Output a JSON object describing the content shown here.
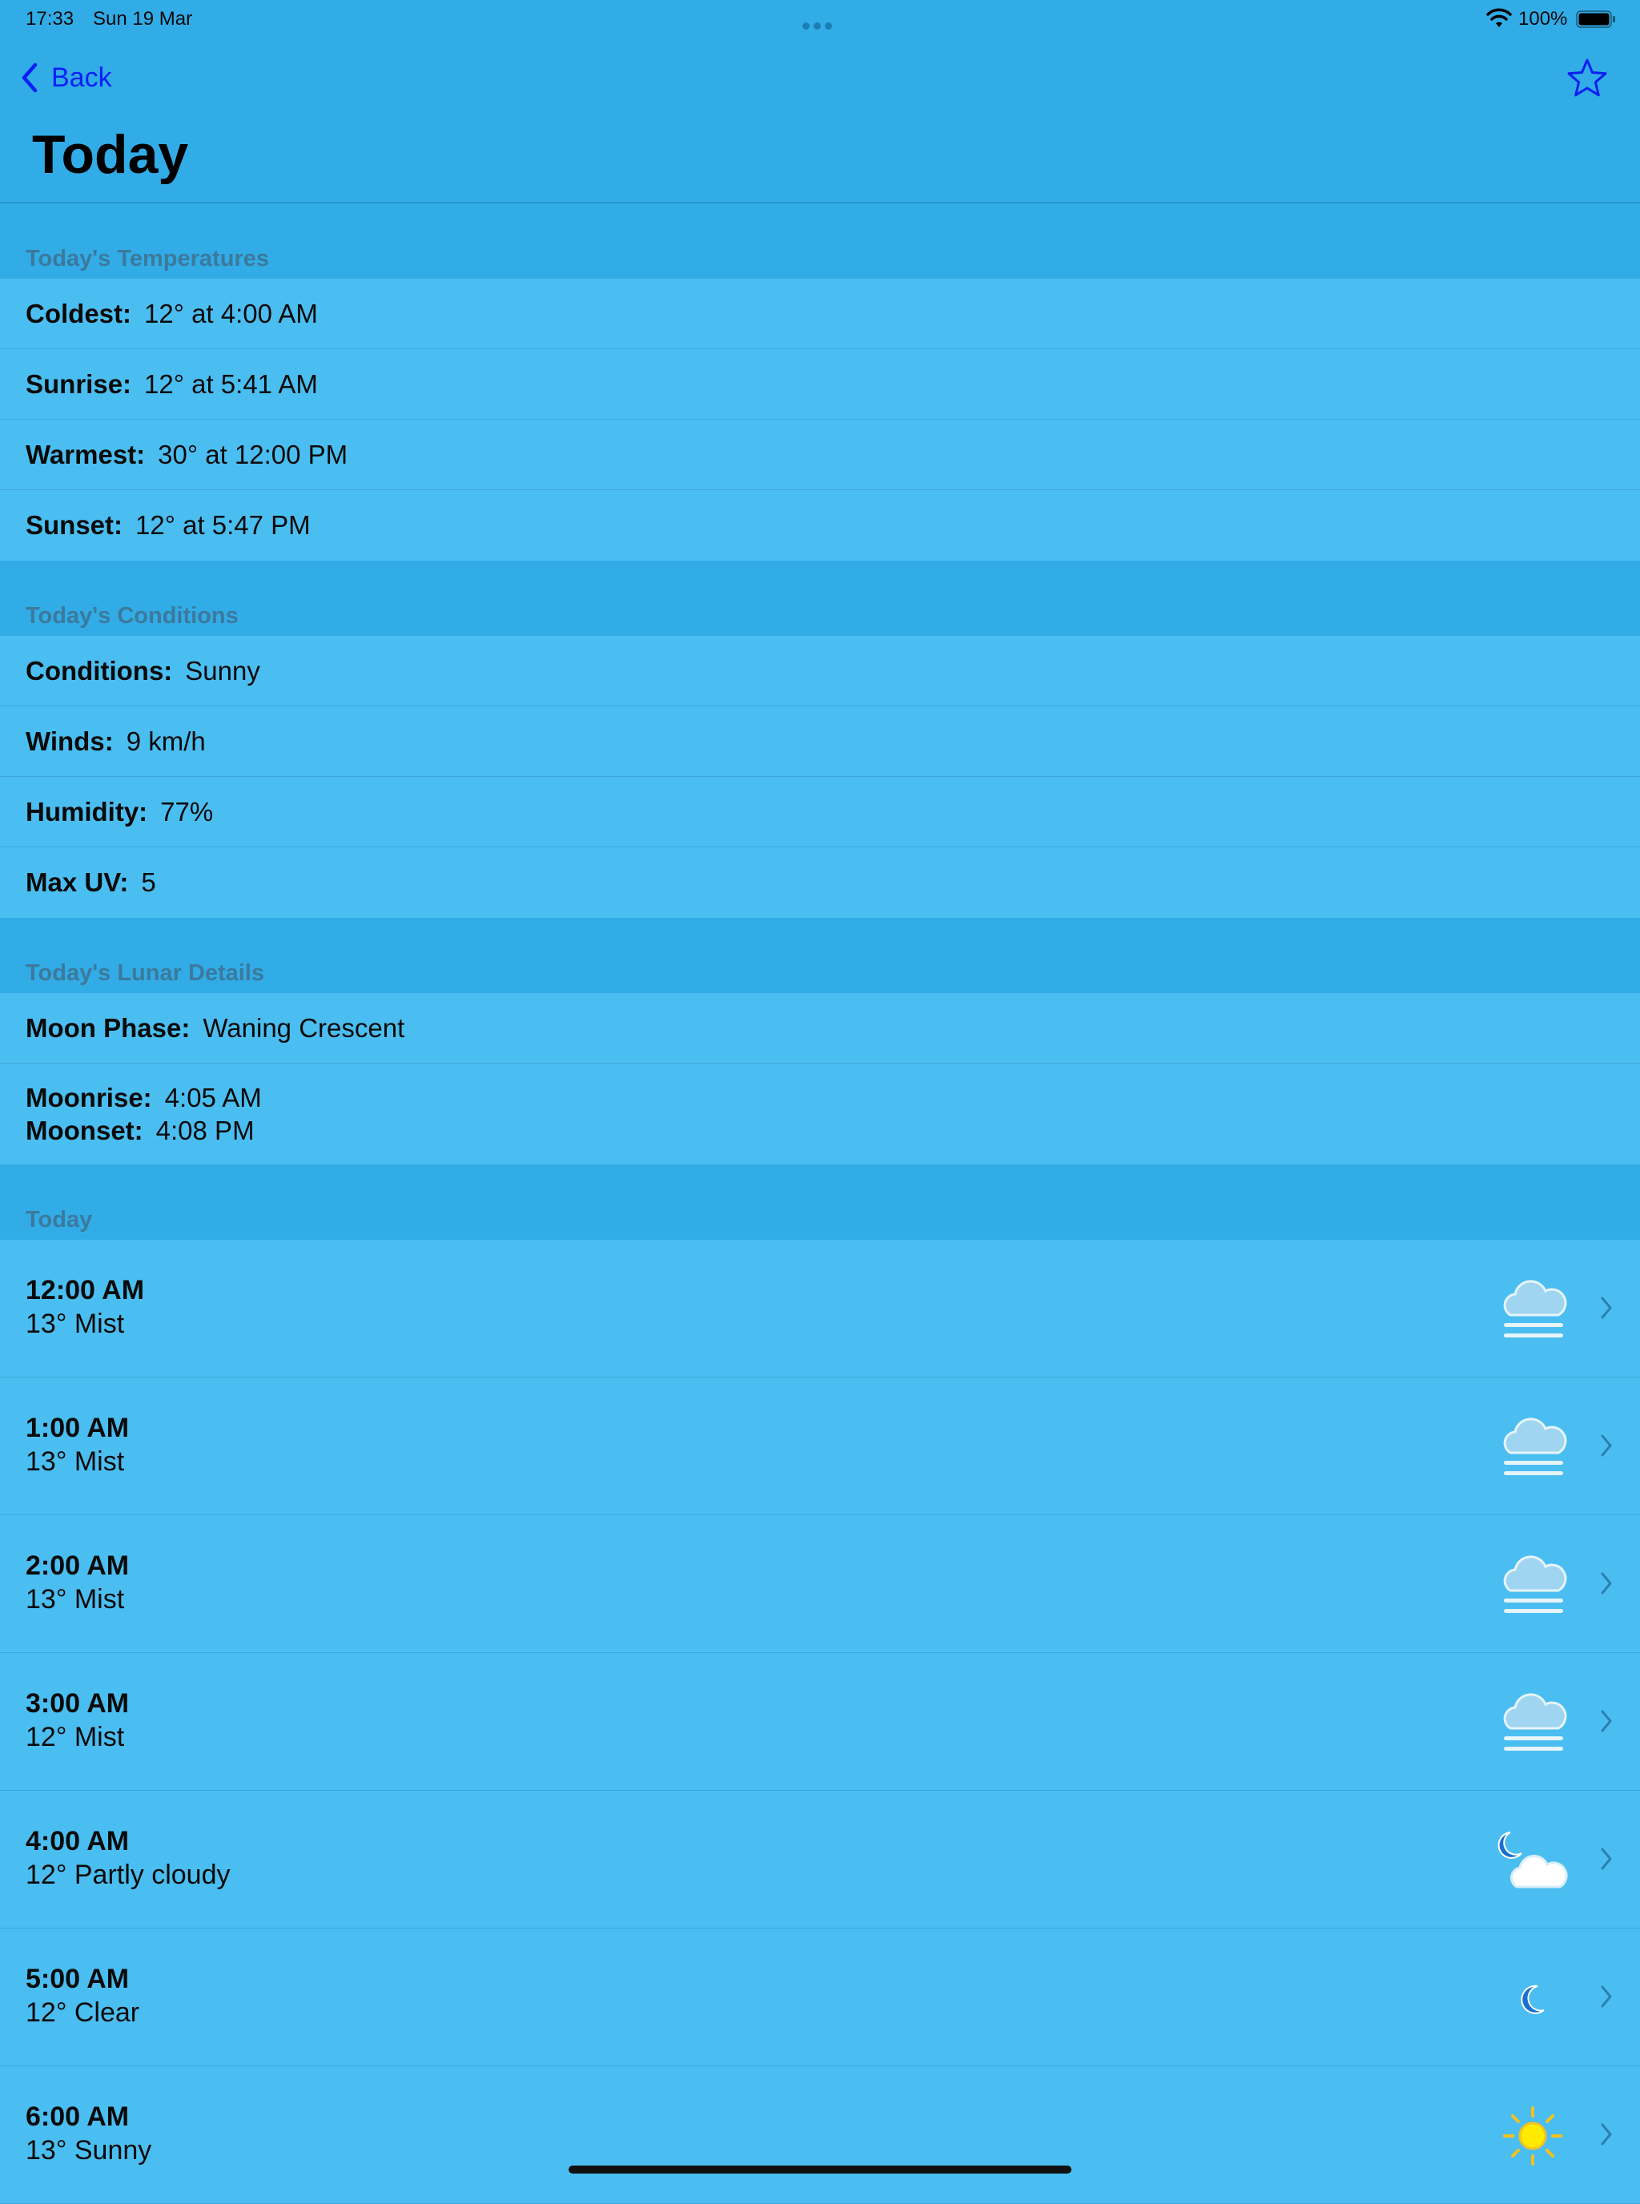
{
  "status": {
    "time": "17:33",
    "date": "Sun 19 Mar",
    "battery": "100%"
  },
  "nav": {
    "back_label": "Back",
    "title": "Today"
  },
  "temperatures": {
    "header": "Today's Temperatures",
    "rows": [
      {
        "key": "Coldest:",
        "value": "12° at 4:00 AM"
      },
      {
        "key": "Sunrise:",
        "value": "12° at 5:41 AM"
      },
      {
        "key": "Warmest:",
        "value": "30° at 12:00 PM"
      },
      {
        "key": "Sunset:",
        "value": "12° at 5:47 PM"
      }
    ]
  },
  "conditions": {
    "header": "Today's Conditions",
    "rows": [
      {
        "key": "Conditions:",
        "value": "Sunny"
      },
      {
        "key": "Winds:",
        "value": "9 km/h"
      },
      {
        "key": "Humidity:",
        "value": "77%"
      },
      {
        "key": "Max UV:",
        "value": "5"
      }
    ]
  },
  "lunar": {
    "header": "Today's Lunar Details",
    "moon_phase_key": "Moon Phase:",
    "moon_phase_value": "Waning Crescent",
    "moonrise_key": "Moonrise:",
    "moonrise_value": "4:05 AM",
    "moonset_key": "Moonset:",
    "moonset_value": "4:08 PM"
  },
  "hourly": {
    "header": "Today",
    "items": [
      {
        "time": "12:00 AM",
        "desc": "13° Mist",
        "icon": "mist-icon"
      },
      {
        "time": "1:00 AM",
        "desc": "13° Mist",
        "icon": "mist-icon"
      },
      {
        "time": "2:00 AM",
        "desc": "13° Mist",
        "icon": "mist-icon"
      },
      {
        "time": "3:00 AM",
        "desc": "12° Mist",
        "icon": "mist-icon"
      },
      {
        "time": "4:00 AM",
        "desc": "12° Partly cloudy",
        "icon": "partly-cloudy-night-icon"
      },
      {
        "time": "5:00 AM",
        "desc": "12° Clear",
        "icon": "moon-icon"
      },
      {
        "time": "6:00 AM",
        "desc": "13° Sunny",
        "icon": "sun-icon"
      }
    ]
  }
}
